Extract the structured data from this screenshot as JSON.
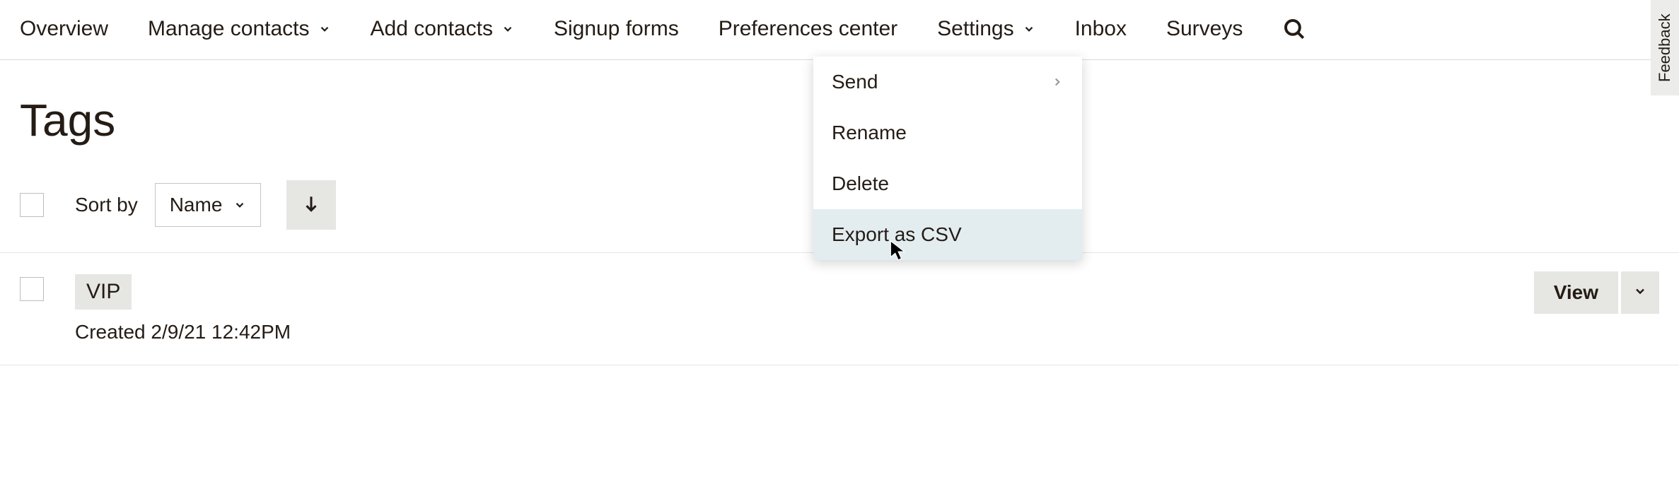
{
  "nav": {
    "overview": "Overview",
    "manage_contacts": "Manage contacts",
    "add_contacts": "Add contacts",
    "signup_forms": "Signup forms",
    "preferences_center": "Preferences center",
    "settings": "Settings",
    "inbox": "Inbox",
    "surveys": "Surveys"
  },
  "page": {
    "title": "Tags"
  },
  "toolbar": {
    "sort_by_label": "Sort by",
    "sort_value": "Name"
  },
  "tags": [
    {
      "name": "VIP",
      "created_label": "Created 2/9/21 12:42PM"
    }
  ],
  "row_actions": {
    "view_label": "View"
  },
  "dropdown": {
    "items": [
      {
        "label": "Send",
        "has_submenu": true
      },
      {
        "label": "Rename",
        "has_submenu": false
      },
      {
        "label": "Delete",
        "has_submenu": false
      },
      {
        "label": "Export as CSV",
        "has_submenu": false
      }
    ]
  },
  "feedback": {
    "label": "Feedback"
  }
}
